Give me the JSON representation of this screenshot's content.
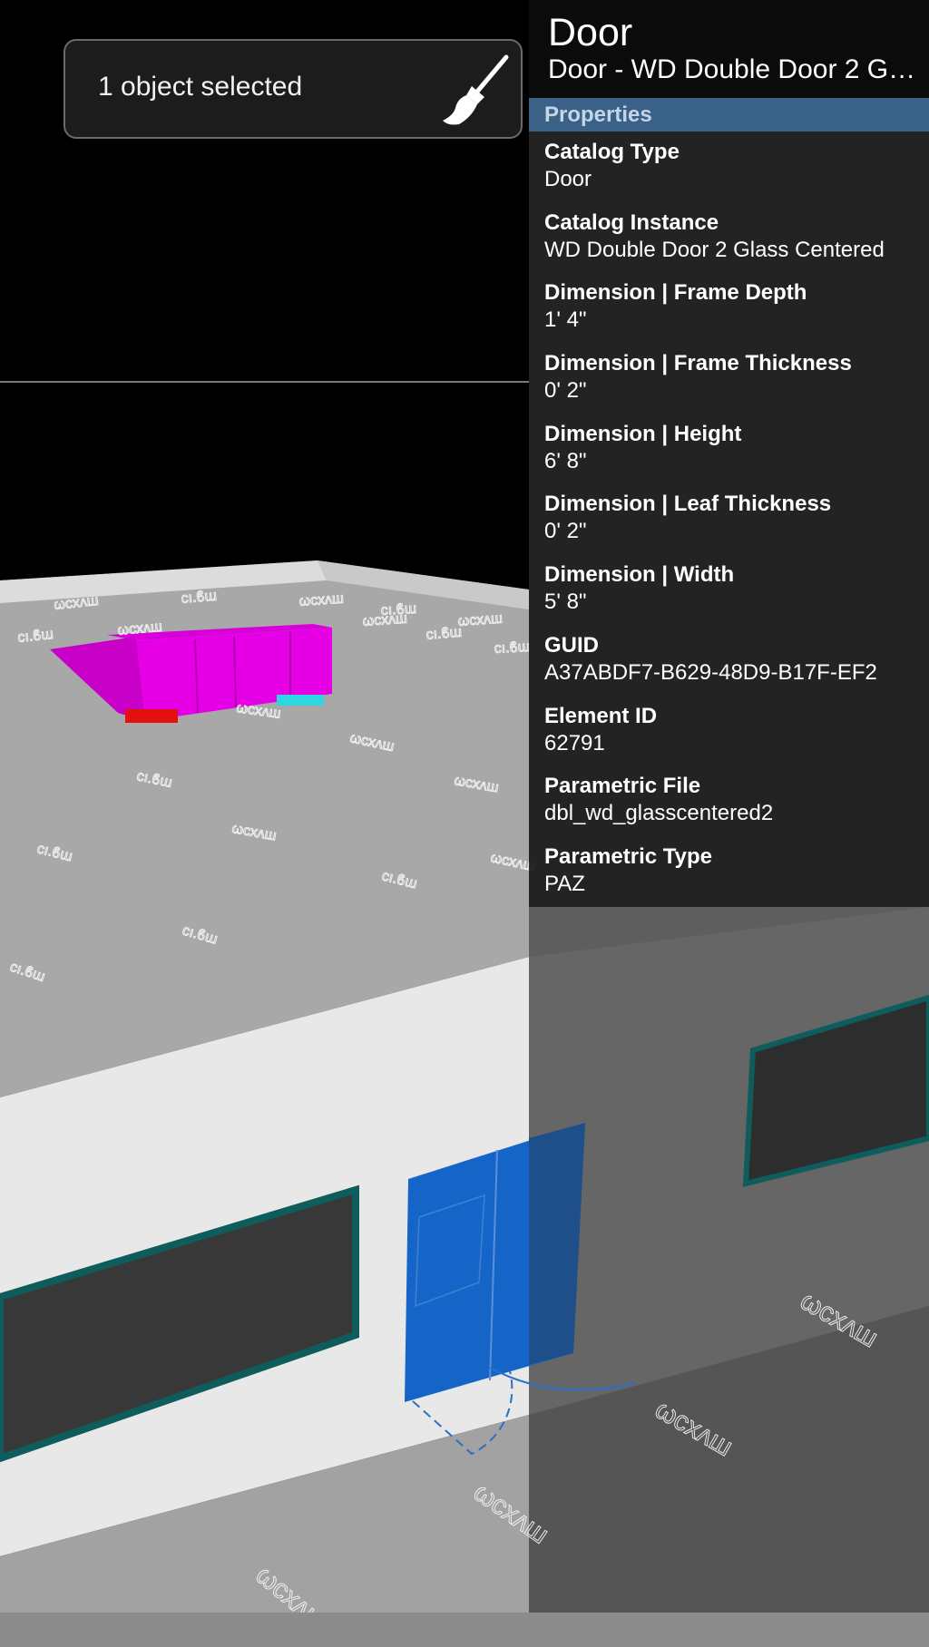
{
  "toast": {
    "text": "1 object selected",
    "icon": "brush-icon"
  },
  "panel": {
    "title": "Door",
    "subtitle": "Door - WD Double Door 2 Glass Centered",
    "section": "Properties",
    "properties": [
      {
        "label": "Catalog Type",
        "value": "Door"
      },
      {
        "label": "Catalog Instance",
        "value": "WD Double Door 2 Glass Centered"
      },
      {
        "label": "Dimension | Frame Depth",
        "value": "1' 4\""
      },
      {
        "label": "Dimension | Frame Thickness",
        "value": "0' 2\""
      },
      {
        "label": "Dimension | Height",
        "value": "6' 8\""
      },
      {
        "label": "Dimension | Leaf Thickness",
        "value": "0' 2\""
      },
      {
        "label": "Dimension | Width",
        "value": "5' 8\""
      },
      {
        "label": "GUID",
        "value": "A37ABDF7-B629-48D9-B17F-EF2"
      },
      {
        "label": "Element ID",
        "value": "62791"
      },
      {
        "label": "Parametric File",
        "value": "dbl_wd_glasscentered2"
      },
      {
        "label": "Parametric Type",
        "value": "PAZ"
      }
    ]
  },
  "scene": {
    "tags": [
      "ωcxʌш",
      "cı.ϐɯ"
    ]
  },
  "colors": {
    "selected": "#1565c8",
    "magenta": "#e600e6",
    "panel_section": "#3a6188",
    "window_trim": "#0f5c5c"
  }
}
